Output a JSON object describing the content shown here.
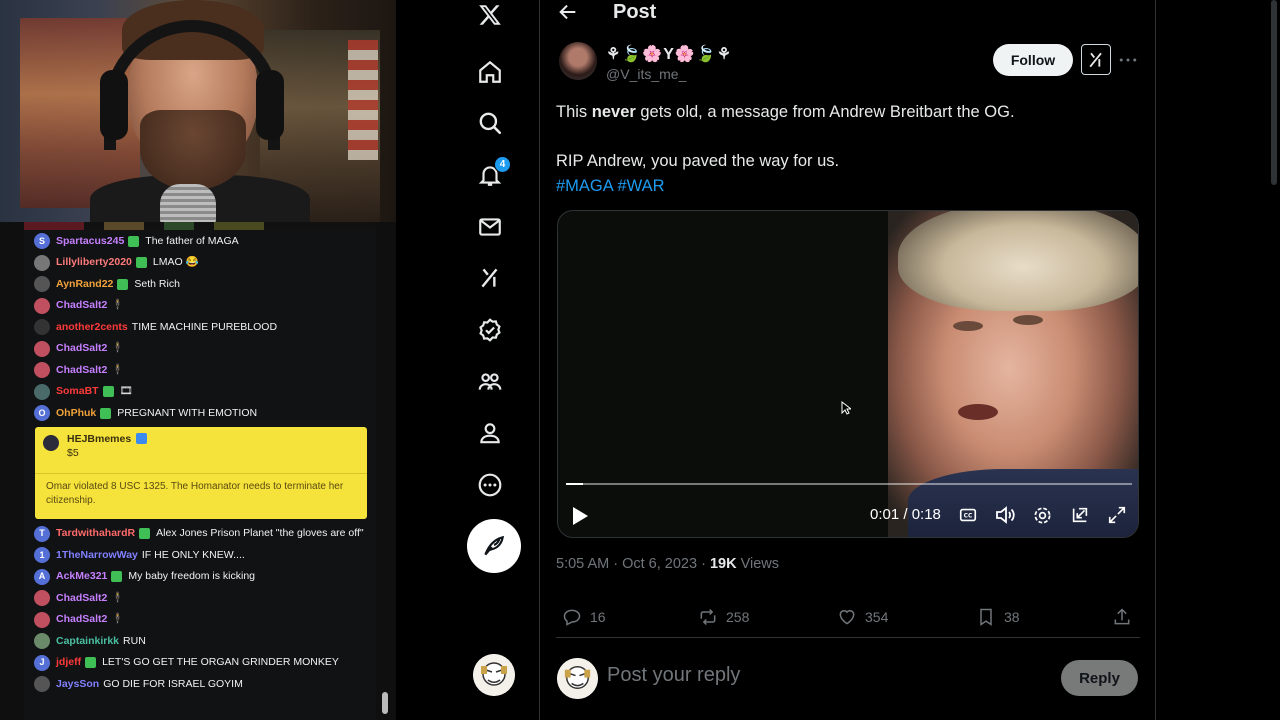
{
  "chat": {
    "messages": [
      {
        "user": "Spartacus245",
        "text": "The father of MAGA",
        "user_color": "#c680ff",
        "avatar_color": "#5470d6",
        "avatar_letter": "S",
        "badge": true
      },
      {
        "user": "Lillyliberty2020",
        "text": "LMAO 😂",
        "user_color": "#ff7a7a",
        "avatar_color": "#777777",
        "avatar_letter": "",
        "badge": true
      },
      {
        "user": "AynRand22",
        "text": "Seth Rich",
        "user_color": "#f0a23a",
        "avatar_color": "#555555",
        "avatar_letter": "",
        "badge": true
      },
      {
        "user": "ChadSalt2",
        "text": "🕴",
        "user_color": "#c680ff",
        "avatar_color": "#c05060",
        "avatar_letter": "",
        "badge": false
      },
      {
        "user": "another2cents",
        "text": "TIME MACHINE PUREBLOOD",
        "user_color": "#ff3a3a",
        "avatar_color": "#333333",
        "avatar_letter": "",
        "badge": false
      },
      {
        "user": "ChadSalt2",
        "text": "🕴",
        "user_color": "#c680ff",
        "avatar_color": "#c05060",
        "avatar_letter": "",
        "badge": false
      },
      {
        "user": "ChadSalt2",
        "text": "🕴",
        "user_color": "#c680ff",
        "avatar_color": "#c05060",
        "avatar_letter": "",
        "badge": false
      },
      {
        "user": "SomaBT",
        "text": "🎞",
        "user_color": "#ff3a3a",
        "avatar_color": "#4a6a6a",
        "avatar_letter": "",
        "badge": true
      },
      {
        "user": "OhPhuk",
        "text": "PREGNANT WITH EMOTION",
        "user_color": "#f0a23a",
        "avatar_color": "#5470d6",
        "avatar_letter": "O",
        "badge": true
      }
    ],
    "superchat": {
      "user": "HEJBmemes",
      "amount": "$5",
      "text": "Omar violated 8 USC 1325. The Homanator needs to terminate her citizenship."
    },
    "messages_after": [
      {
        "user": "TardwithahardR",
        "text": "Alex Jones Prison Planet \"the gloves are off\"",
        "user_color": "#ff6a6a",
        "avatar_color": "#5470d6",
        "avatar_letter": "T",
        "badge": true
      },
      {
        "user": "1TheNarrowWay",
        "text": "IF HE ONLY KNEW....",
        "user_color": "#8080ff",
        "avatar_color": "#5470d6",
        "avatar_letter": "1",
        "badge": false
      },
      {
        "user": "AckMe321",
        "text": "My baby freedom is kicking",
        "user_color": "#c680ff",
        "avatar_color": "#5470d6",
        "avatar_letter": "A",
        "badge": true
      },
      {
        "user": "ChadSalt2",
        "text": "🕴",
        "user_color": "#c680ff",
        "avatar_color": "#c05060",
        "avatar_letter": "",
        "badge": false
      },
      {
        "user": "ChadSalt2",
        "text": "🕴",
        "user_color": "#c680ff",
        "avatar_color": "#c05060",
        "avatar_letter": "",
        "badge": false
      },
      {
        "user": "Captainkirkk",
        "text": "RUN",
        "user_color": "#4ac0a0",
        "avatar_color": "#6a8a6a",
        "avatar_letter": "",
        "badge": false
      },
      {
        "user": "jdjeff",
        "text": "LET'S GO GET THE ORGAN GRINDER MONKEY",
        "user_color": "#ff3a3a",
        "avatar_color": "#5470d6",
        "avatar_letter": "J",
        "badge": true
      },
      {
        "user": "JaysSon",
        "text": "GO DIE FOR ISRAEL GOYIM",
        "user_color": "#8080ff",
        "avatar_color": "#555555",
        "avatar_letter": "",
        "badge": false
      }
    ]
  },
  "nav": {
    "notification_count": "4"
  },
  "post": {
    "header_title": "Post",
    "author_name": "⚘🍃🌸Y🌸🍃⚘",
    "author_handle": "@V_its_me_",
    "follow_label": "Follow",
    "text_line1_pre": "This ",
    "text_line1_bold": "never",
    "text_line1_post": " gets old, a message from Andrew Breitbart the OG.",
    "text_line2": "RIP Andrew, you paved the way for us.",
    "hashtags": [
      "#MAGA",
      "#WAR"
    ],
    "video": {
      "time": "0:01 / 0:18",
      "progress": 0.03
    },
    "timestamp": "5:05 AM · Oct 6, 2023 · ",
    "views_count": "19K",
    "views_label": " Views",
    "replies": "16",
    "reposts": "258",
    "likes": "354",
    "bookmarks": "38",
    "reply_placeholder": "Post your reply",
    "reply_button": "Reply"
  }
}
